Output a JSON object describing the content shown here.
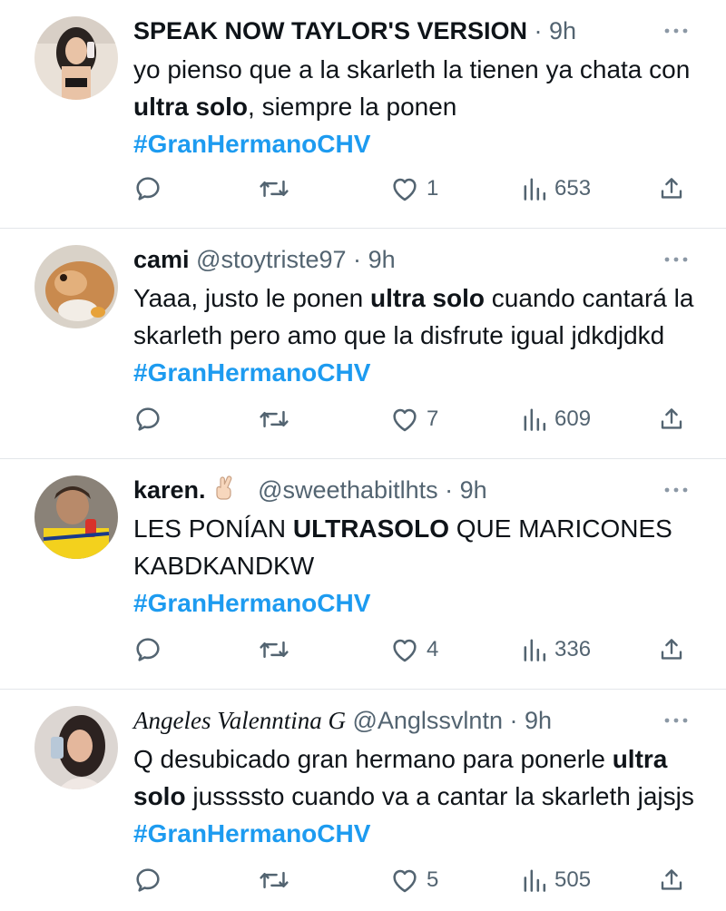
{
  "tweets": [
    {
      "name": "SPEAK NOW TAYLOR'S VERSION",
      "handle": "",
      "time": "9h",
      "text_parts": [
        {
          "t": "yo pienso que a la skarleth la tienen ya chata con ",
          "style": "plain"
        },
        {
          "t": "ultra solo",
          "style": "bold"
        },
        {
          "t": ", siempre la ponen ",
          "style": "plain"
        },
        {
          "t": "#GranHermanoCHV",
          "style": "tag"
        }
      ],
      "likes": "1",
      "views": "653"
    },
    {
      "name": "cami",
      "handle": "@stoytriste97",
      "time": "9h",
      "text_parts": [
        {
          "t": "Yaaa, justo le ponen ",
          "style": "plain"
        },
        {
          "t": "ultra solo",
          "style": "bold"
        },
        {
          "t": " cuando cantará la skarleth pero amo que la disfrute igual jdkdjdkd ",
          "style": "plain"
        },
        {
          "t": "#GranHermanoCHV",
          "style": "tag"
        }
      ],
      "likes": "7",
      "views": "609"
    },
    {
      "name": "karen.",
      "handle": "@sweethabitlhts",
      "time": "9h",
      "text_parts": [
        {
          "t": "LES PONÍAN ",
          "style": "plain"
        },
        {
          "t": "ULTRASOLO",
          "style": "bold"
        },
        {
          "t": " QUE MARICONES KABDKANDKW ",
          "style": "plain"
        },
        {
          "t": "#GranHermanoCHV",
          "style": "tag"
        }
      ],
      "likes": "4",
      "views": "336"
    },
    {
      "name": "Angeles Valenntina G",
      "handle": "@Anglssvlntn",
      "time": "9h",
      "text_parts": [
        {
          "t": "Q desubicado gran hermano para ponerle ",
          "style": "plain"
        },
        {
          "t": "ultra solo",
          "style": "bold"
        },
        {
          "t": " jussssto cuando va a cantar la skarleth jajsjs ",
          "style": "plain"
        },
        {
          "t": "#GranHermanoCHV",
          "style": "tag"
        }
      ],
      "likes": "5",
      "views": "505"
    }
  ],
  "separator": "·",
  "icons": {
    "reply": "speech-bubble-icon",
    "retweet": "retweet-arrows-icon",
    "like": "heart-outline-icon",
    "views": "bar-chart-icon",
    "share": "share-upload-icon",
    "more": "ellipsis-icon",
    "emoji": "crossed-fingers-emoji"
  },
  "colors": {
    "hashtag": "#1d9bf0",
    "secondary_text": "#536471",
    "divider": "#e3e6ea"
  }
}
